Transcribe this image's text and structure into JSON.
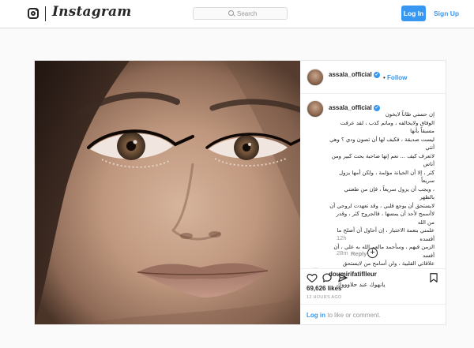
{
  "header": {
    "logo_text": "Instagram",
    "search_placeholder": "Search",
    "login_label": "Log In",
    "signup_label": "Sign Up"
  },
  "post": {
    "username": "assala_official",
    "follow_separator": "•",
    "follow_label": "Follow",
    "caption_username": "assala_official",
    "caption_lines": [
      "إن حسني ظاناً لايخون",
      "الوفاق ولايخالفه ، وماتم كذب ، لقد عرفت مسبقاً بأنها",
      "ليست صديقة ، فكيف لها أن تصون ودي ؟ وهي أتتي",
      "لاتعرف كيف ... نعم إنها صاحبة بحث كبير ومن أناس",
      "كثر ، إلا أن الخيانة مؤلمة ، ولكن أمها يزول سريعاً",
      "، ويجب أن يزول سريعاً ، فإن من طعنني بالظهر",
      "لايستحق أن يوجع قلبي ، وقد تعهدت لروحي أن",
      "لاأسمح لأحد أن يمسها ، فالجروح كثر ، وقدر من الله",
      "علمني بنعمة الاختبار ، إن أحاول أن أصلح ما أفسده",
      "الزمن فيهم ، وسأحمد مالعم الله به علي ، أن أفسد",
      "علاقاتي القلبية ، ولن أسامح من لايستحق #اصالة"
    ],
    "caption_time": "12h",
    "comment2_username": "doumirifatiflleur",
    "comment2_text": "يانهوك عند حلاوووك",
    "comment2_time": "28m",
    "comment2_reply": "Reply",
    "likes": "69,626 likes",
    "time_ago": "12 HOURS AGO",
    "login_link": "Log in",
    "login_suffix": " to like or comment."
  },
  "colors": {
    "accent": "#3897f0",
    "border": "#dbdbdb",
    "muted": "#999999",
    "text": "#262626"
  },
  "icons": [
    "instagram-logo-icon",
    "search-icon",
    "verified-badge-icon",
    "add-comment-icon",
    "heart-icon",
    "comment-icon",
    "share-icon",
    "bookmark-icon"
  ]
}
